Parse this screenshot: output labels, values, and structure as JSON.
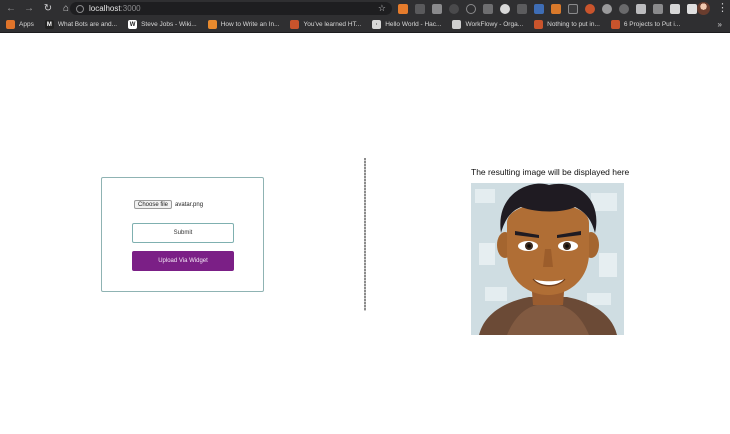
{
  "browser": {
    "url_host": "localhost",
    "url_port": ":3000",
    "bookmarks": [
      {
        "label": "Apps",
        "icon": "apps-grid-icon",
        "color": "#e0742a"
      },
      {
        "label": "What Bots are and...",
        "icon": "medium-icon",
        "color": "#222222",
        "glyph": "M"
      },
      {
        "label": "Steve Jobs - Wiki...",
        "icon": "wikipedia-icon",
        "color": "#ffffff",
        "glyph": "W"
      },
      {
        "label": "How to Write an In...",
        "icon": "document-icon",
        "color": "#e88a2e"
      },
      {
        "label": "You've learned HT...",
        "icon": "freecodecamp-icon",
        "color": "#c9542c"
      },
      {
        "label": "Hello World - Hac...",
        "icon": "hackernoon-icon",
        "color": "#d8d8d8",
        "glyph": "·"
      },
      {
        "label": "WorkFlowy - Orga...",
        "icon": "workflowy-icon",
        "color": "#cfcfcf"
      },
      {
        "label": "Nothing to put in...",
        "icon": "freecodecamp-icon",
        "color": "#c9542c"
      },
      {
        "label": "6 Projects to Put i...",
        "icon": "freecodecamp-icon",
        "color": "#c9542c"
      }
    ]
  },
  "form": {
    "choose_file_label": "Choose file",
    "file_name": "avatar.png",
    "submit_label": "Submit",
    "widget_label": "Upload Via Widget"
  },
  "result": {
    "caption": "The resulting image will be displayed here"
  }
}
